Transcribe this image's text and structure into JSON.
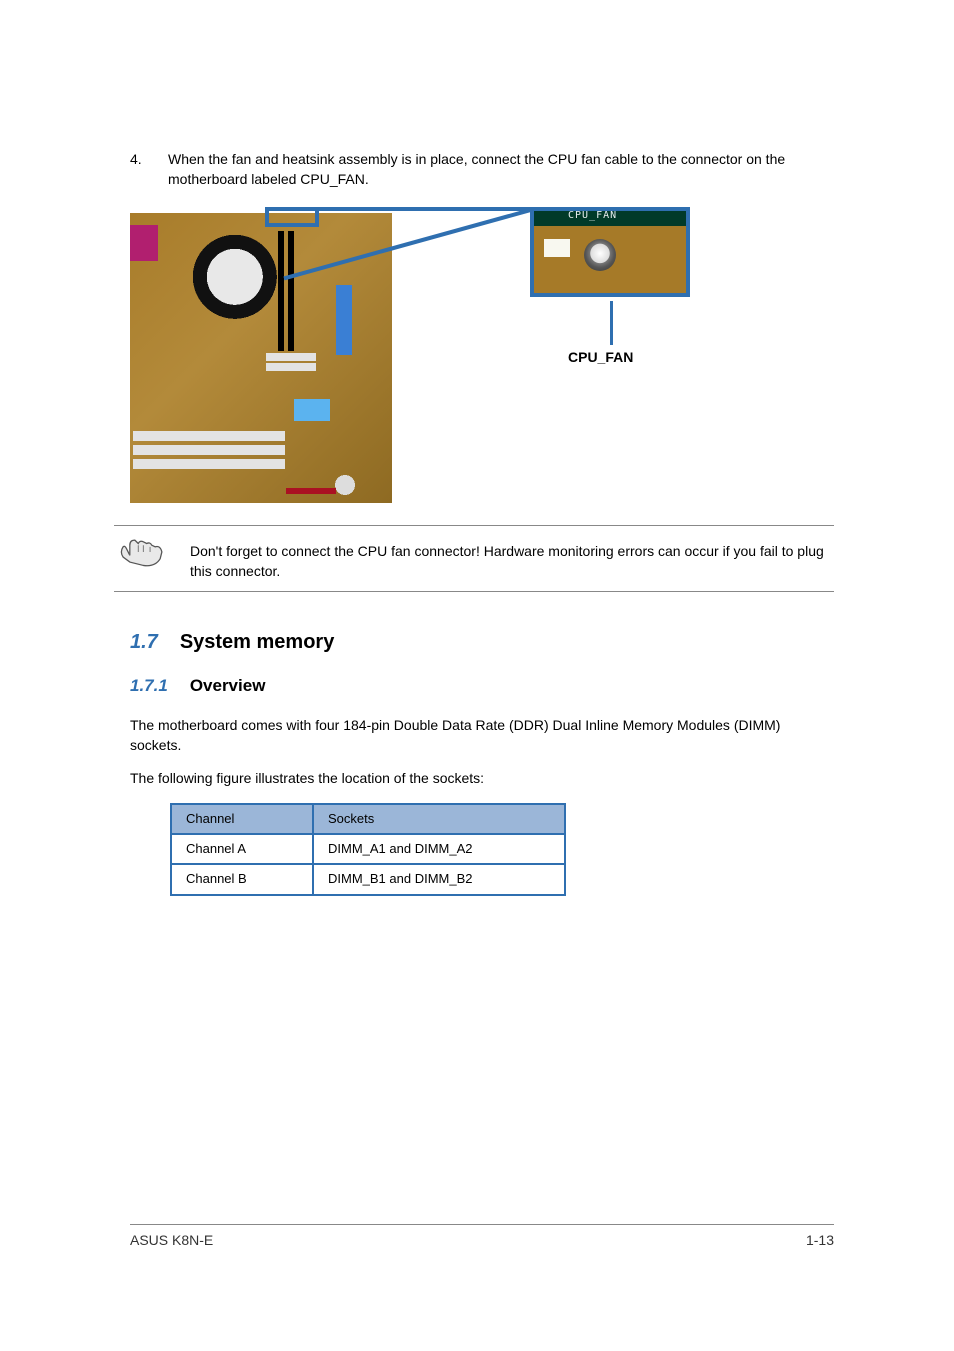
{
  "step": {
    "number": "4.",
    "text": "When the fan and heatsink assembly is in place, connect the CPU fan cable to the connector on the motherboard labeled CPU_FAN."
  },
  "callout": {
    "topText": "CPU_FAN",
    "label": "CPU_FAN"
  },
  "note": {
    "text": "Don't forget to connect the CPU fan connector! Hardware monitoring errors can occur if you fail to plug this connector."
  },
  "section": {
    "number": "1.7",
    "title": "System memory"
  },
  "subsection": {
    "number": "1.7.1",
    "title": "Overview"
  },
  "paragraphs": {
    "p1": "The motherboard comes with four 184-pin Double Data Rate (DDR) Dual Inline Memory Modules (DIMM) sockets.",
    "p2": "The following figure illustrates the location of the sockets:"
  },
  "chart_data": {
    "type": "table",
    "title": "",
    "columns": [
      "Channel",
      "Sockets"
    ],
    "rows": [
      [
        "Channel A",
        "DIMM_A1 and DIMM_A2"
      ],
      [
        "Channel B",
        "DIMM_B1 and DIMM_B2"
      ]
    ]
  },
  "footer": {
    "left": "ASUS K8N-E",
    "right": "1-13"
  }
}
